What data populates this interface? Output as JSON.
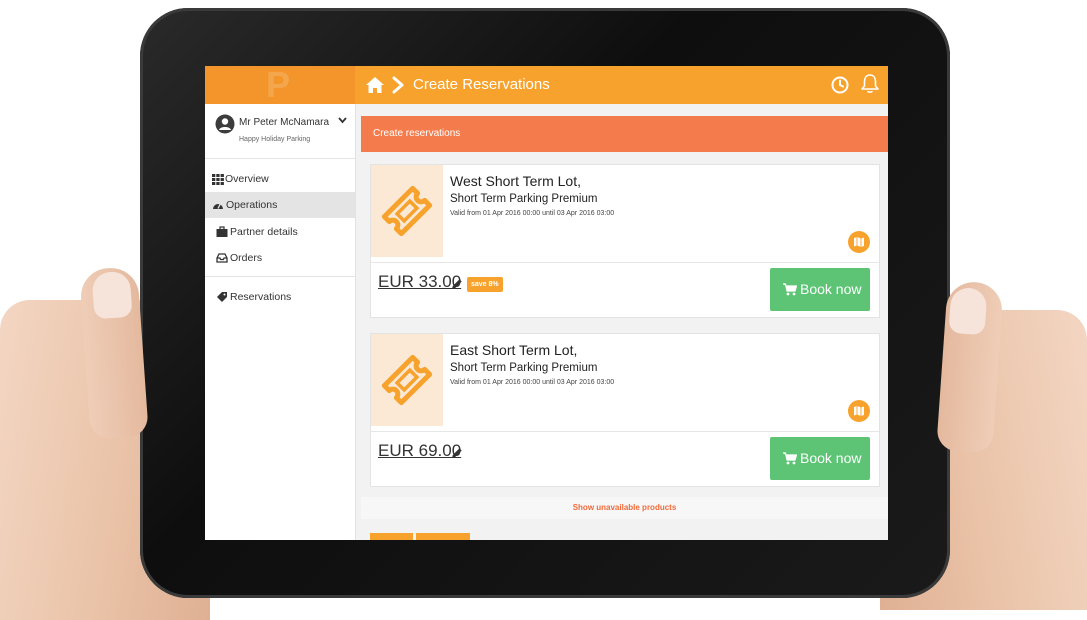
{
  "header": {
    "title": "Create Reservations",
    "home_icon": "home-icon",
    "breadcrumb_icon": "chevron-right-icon",
    "actions": [
      "clock-icon",
      "bell-icon"
    ]
  },
  "user": {
    "name": "Mr Peter McNamara",
    "company": "Happy Holiday Parking"
  },
  "sidebar": {
    "items": [
      {
        "label": "Overview",
        "icon": "grid-icon"
      },
      {
        "label": "Operations",
        "icon": "dashboard-icon"
      },
      {
        "label": "Partner details",
        "icon": "briefcase-icon"
      },
      {
        "label": "Orders",
        "icon": "inbox-icon"
      },
      {
        "label": "Reservations",
        "icon": "tag-icon"
      }
    ],
    "active": "Operations"
  },
  "section": {
    "title": "Create reservations"
  },
  "products": [
    {
      "lot": "West Short Term Lot,",
      "product": "Short Term Parking Premium",
      "validity": "Valid from 01 Apr 2016 00:00 until 03 Apr 2016 03:00",
      "price": "EUR 33.00",
      "badge": "save 8%",
      "button": "Book now"
    },
    {
      "lot": "East Short Term Lot,",
      "product": "Short Term Parking Premium",
      "validity": "Valid from 01 Apr 2016 00:00 until 03 Apr 2016 03:00",
      "price": "EUR 69.00",
      "button": "Book now"
    }
  ],
  "footer": {
    "show_unavailable": "Show unavailable products"
  },
  "colors": {
    "topbar": "#f7a22c",
    "section_header": "#f47c4c",
    "book_button": "#5cc474",
    "badge": "#f7a22c",
    "active_nav": "#e4e4e4"
  }
}
